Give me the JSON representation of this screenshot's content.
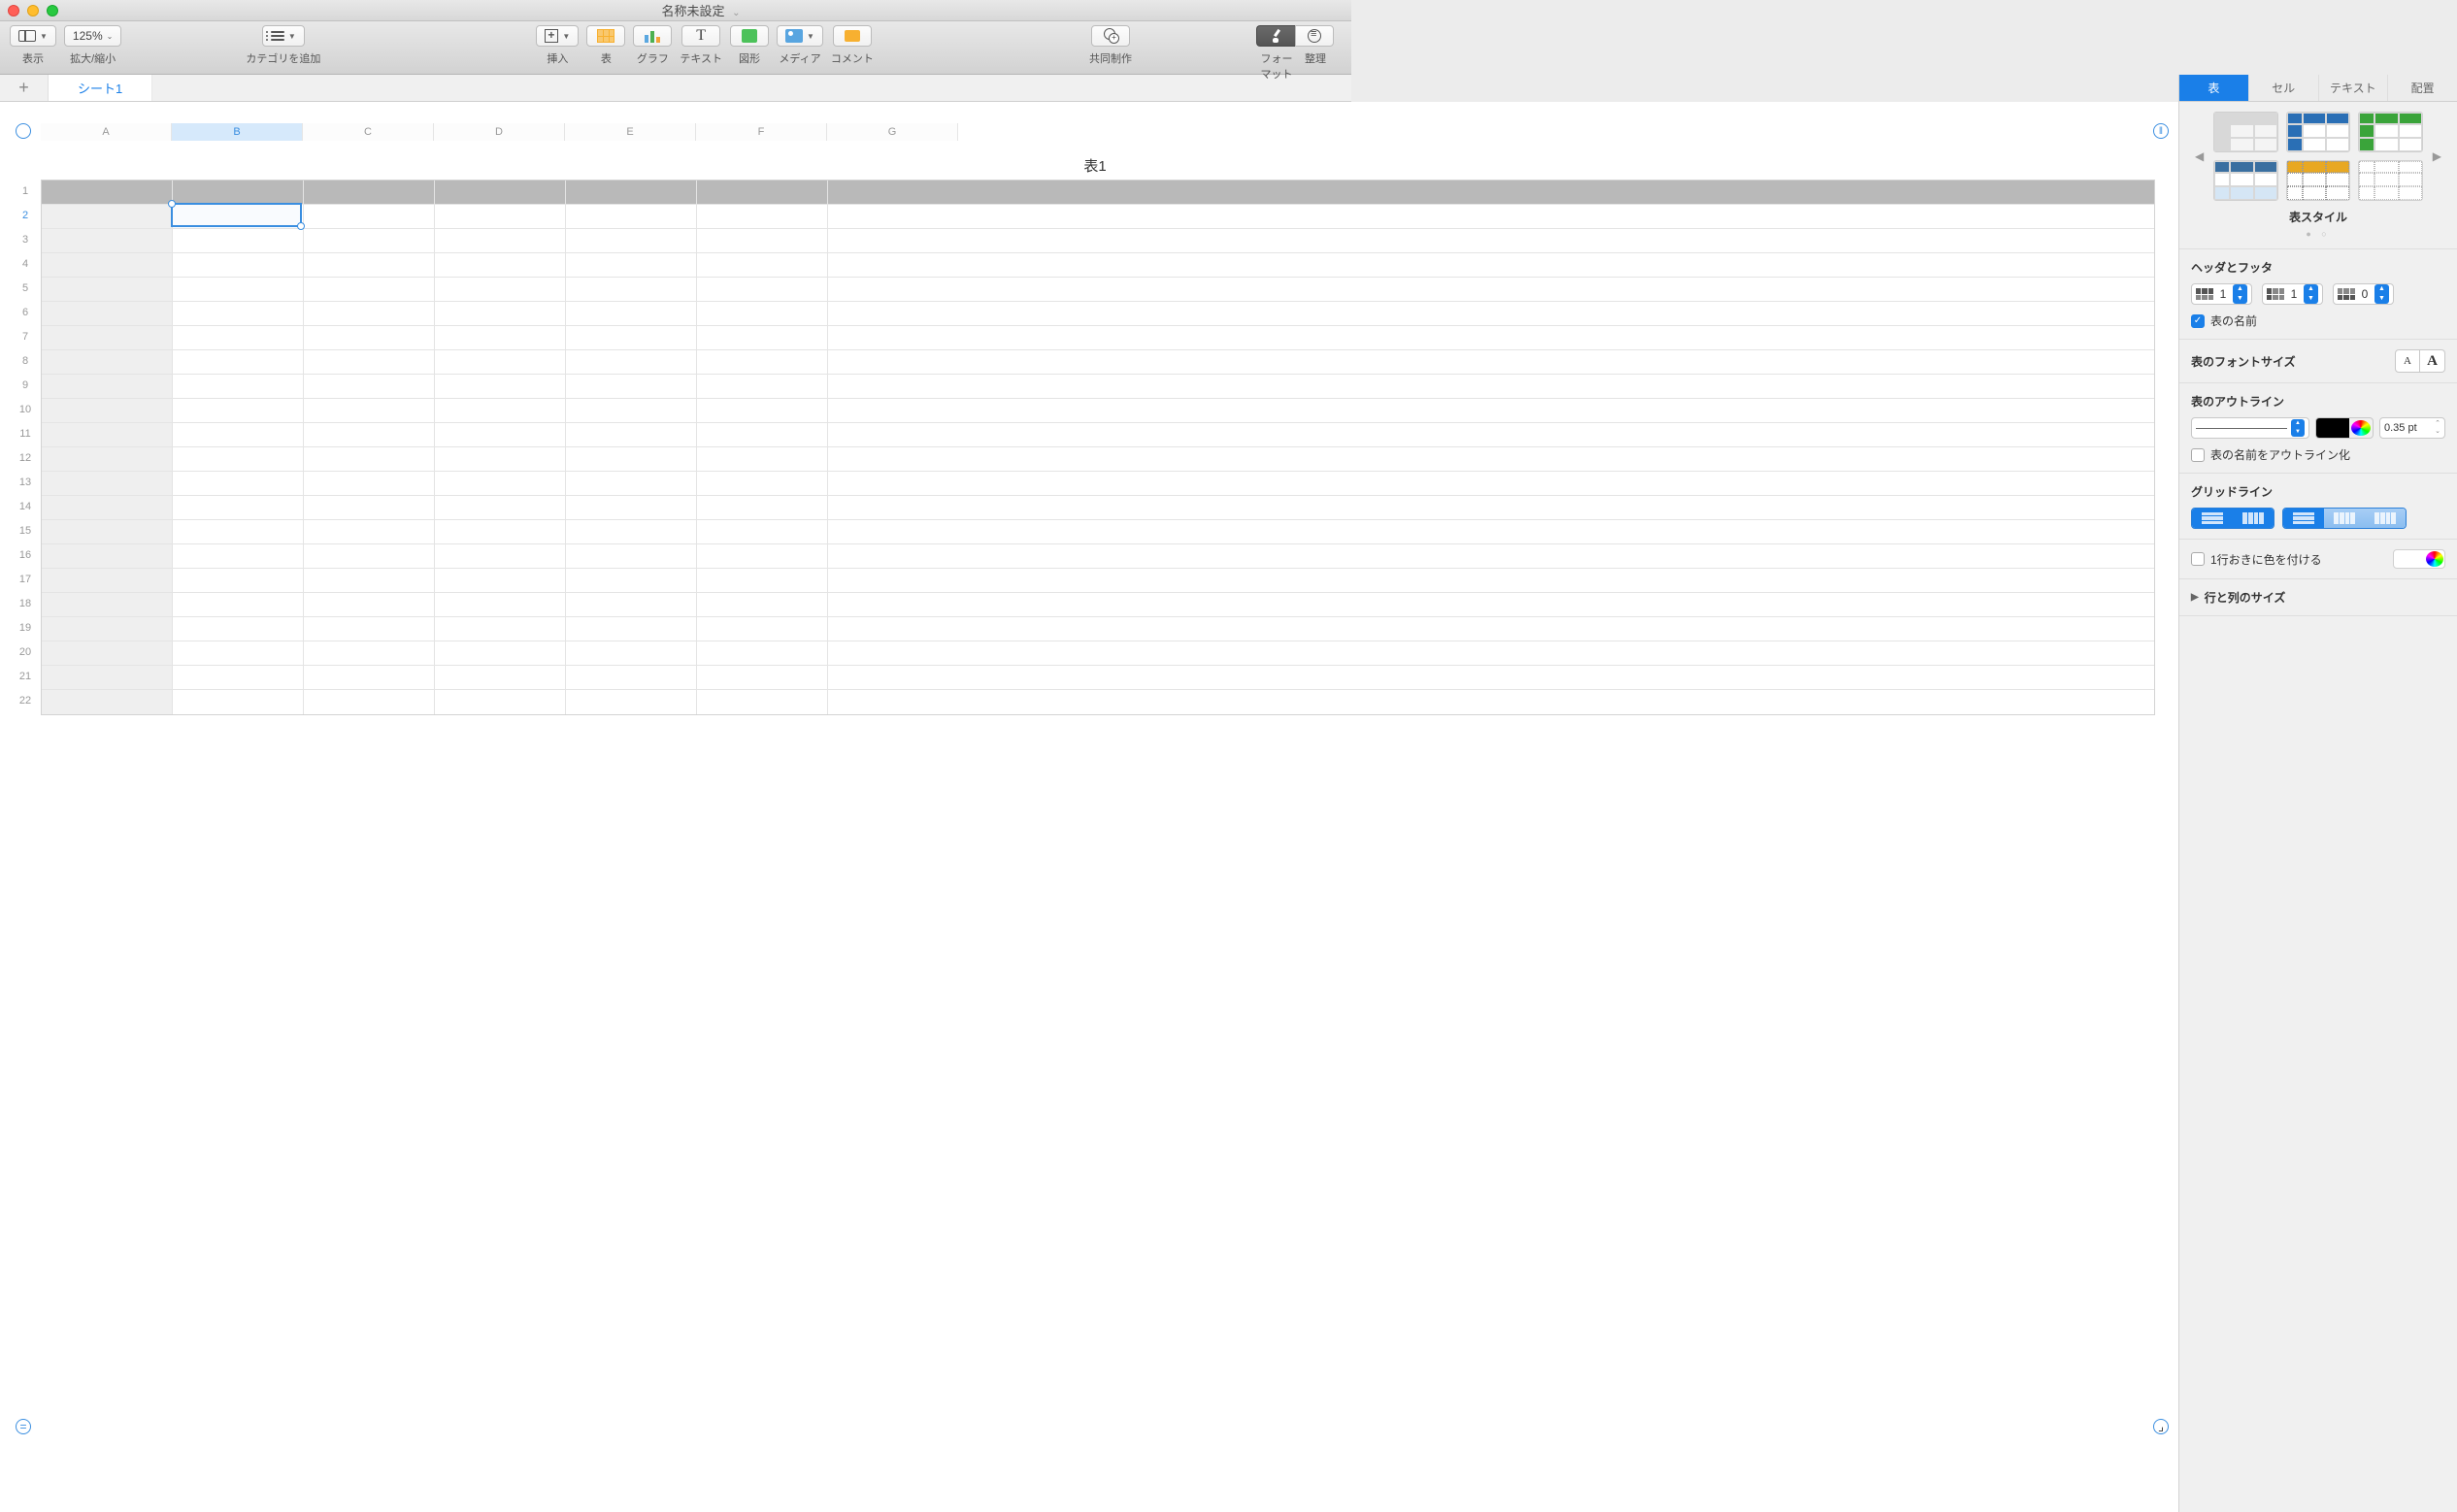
{
  "window": {
    "title": "名称未設定"
  },
  "toolbar": {
    "view": "表示",
    "zoom_value": "125%",
    "zoom_label": "拡大/縮小",
    "category": "カテゴリを追加",
    "insert": "挿入",
    "table": "表",
    "chart": "グラフ",
    "text": "テキスト",
    "shape": "図形",
    "media": "メディア",
    "comment": "コメント",
    "collaborate": "共同制作",
    "format": "フォーマット",
    "organize": "整理"
  },
  "sheets": {
    "tab1": "シート1"
  },
  "spreadsheet": {
    "title": "表1",
    "columns": [
      "A",
      "B",
      "C",
      "D",
      "E",
      "F",
      "G"
    ],
    "rows": [
      "1",
      "2",
      "3",
      "4",
      "5",
      "6",
      "7",
      "8",
      "9",
      "10",
      "11",
      "12",
      "13",
      "14",
      "15",
      "16",
      "17",
      "18",
      "19",
      "20",
      "21",
      "22"
    ],
    "selected_col": "B",
    "selected_row": "2"
  },
  "inspector": {
    "subtabs": {
      "table": "表",
      "cell": "セル",
      "text": "テキスト",
      "arrange": "配置"
    },
    "style_caption": "表スタイル",
    "header_footer": {
      "title": "ヘッダとフッタ",
      "header_rows": "1",
      "header_cols": "1",
      "footer_rows": "0",
      "show_name": "表の名前"
    },
    "font_size_label": "表のフォントサイズ",
    "outline": {
      "title": "表のアウトライン",
      "pt": "0.35 pt",
      "outline_name": "表の名前をアウトライン化"
    },
    "gridlines": {
      "title": "グリッドライン"
    },
    "alternating": "1行おきに色を付ける",
    "row_col_size": "行と列のサイズ"
  }
}
